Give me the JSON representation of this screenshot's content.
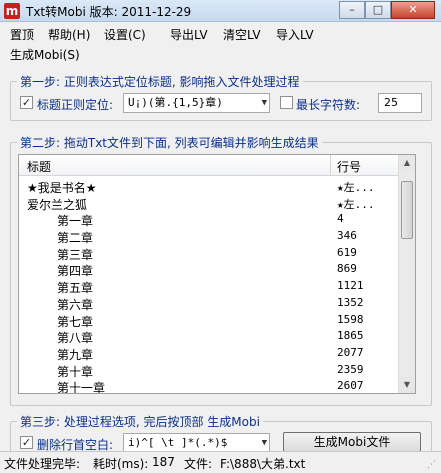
{
  "window": {
    "app_icon_letter": "m",
    "title": "Txt转Mobi  版本: 2011-12-29",
    "minimize": "–",
    "maximize": "□",
    "close": "✕"
  },
  "menu": {
    "items": [
      "置顶",
      "帮助(H)",
      "设置(C)",
      "导出LV",
      "清空LV",
      "导入LV"
    ],
    "second_row": [
      "生成Mobi(S)"
    ]
  },
  "step1": {
    "title": "第一步: 正则表达式定位标题, 影响拖入文件处理过程",
    "regex_checkbox_checked": true,
    "regex_label": "标题正则定位:",
    "regex_value": "U¡)(第.{1,5}章)",
    "maxlen_checkbox_checked": false,
    "maxlen_label": "最长字符数:",
    "maxlen_value": "25"
  },
  "step2": {
    "title": "第二步: 拖动Txt文件到下面, 列表可编辑并影响生成结果",
    "columns": [
      "标题",
      "行号"
    ],
    "rows": [
      {
        "title": "★我是书名★",
        "line": "★左...",
        "indent": false
      },
      {
        "title": "爱尔兰之狐",
        "line": "★左...",
        "indent": false
      },
      {
        "title": "第一章",
        "line": "4",
        "indent": true
      },
      {
        "title": "第二章",
        "line": "346",
        "indent": true
      },
      {
        "title": "第三章",
        "line": "619",
        "indent": true
      },
      {
        "title": "第四章",
        "line": "869",
        "indent": true
      },
      {
        "title": "第五章",
        "line": "1121",
        "indent": true
      },
      {
        "title": "第六章",
        "line": "1352",
        "indent": true
      },
      {
        "title": "第七章",
        "line": "1598",
        "indent": true
      },
      {
        "title": "第八章",
        "line": "1865",
        "indent": true
      },
      {
        "title": "第九章",
        "line": "2077",
        "indent": true
      },
      {
        "title": "第十章",
        "line": "2359",
        "indent": true
      },
      {
        "title": "第十一章",
        "line": "2607",
        "indent": true
      }
    ]
  },
  "step3": {
    "title": "第三步: 处理过程选项, 完后按顶部 生成Mobi",
    "option_checked": true,
    "option_label": "删除行首空白:",
    "option_value": "i)^[ \\t  ]*(.*)$",
    "generate_label": "生成Mobi文件"
  },
  "status": {
    "state": "文件处理完毕:",
    "time_label": "耗时(ms):",
    "time_value": "187",
    "file_label": "文件:",
    "file_value": "F:\\888\\大弟.txt"
  }
}
